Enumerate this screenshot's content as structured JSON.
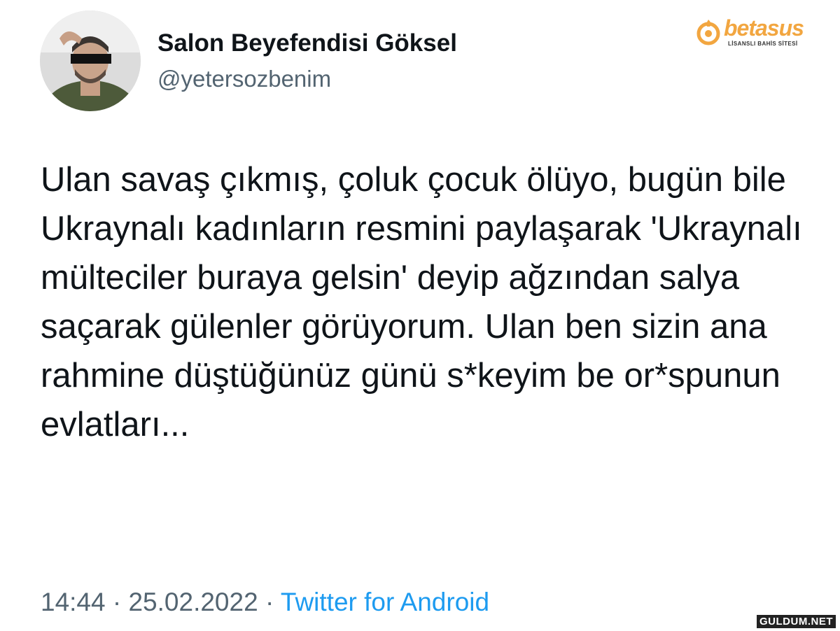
{
  "author": {
    "display_name": "Salon Beyefendisi Göksel",
    "handle": "@yetersozbenim"
  },
  "tweet": {
    "text": "Ulan savaş çıkmış, çoluk çocuk ölüyo, bugün bile Ukraynalı kadınların resmini paylaşarak 'Ukraynalı mülteciler buraya gelsin' deyip ağzından salya saçarak gülenler görüyorum. Ulan ben sizin ana rahmine düştüğünüz günü s*keyim be or*spunun evlatları..."
  },
  "meta": {
    "time": "14:44",
    "separator_1": " · ",
    "date": "25.02.2022",
    "separator_2": " · ",
    "source": "Twitter for Android"
  },
  "watermark": {
    "brand": "betasus",
    "tagline": "LİSANSLI BAHİS SİTESİ",
    "site": "GULDUM.NET"
  },
  "colors": {
    "link": "#1d9bf0",
    "secondary_text": "#536471",
    "primary_text": "#0f1419",
    "brand_accent": "#f2a640"
  }
}
